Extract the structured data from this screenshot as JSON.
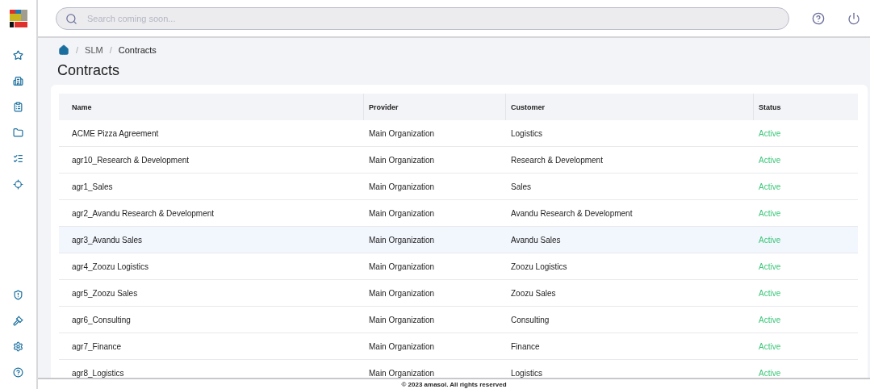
{
  "search": {
    "placeholder": "Search coming soon..."
  },
  "breadcrumb": [
    {
      "kind": "separator",
      "text": "/"
    },
    {
      "kind": "link",
      "text": "SLM"
    },
    {
      "kind": "separator",
      "text": "/"
    },
    {
      "kind": "current",
      "text": "Contracts"
    }
  ],
  "title": "Contracts",
  "table": {
    "columns": [
      "Name",
      "Provider",
      "Customer",
      "Status"
    ],
    "rows": [
      {
        "name": "ACME Pizza Agreement",
        "provider": "Main Organization",
        "customer": "Logistics",
        "status": "Active",
        "selected": false
      },
      {
        "name": "agr10_Research & Development",
        "provider": "Main Organization",
        "customer": "Research & Development",
        "status": "Active",
        "selected": false
      },
      {
        "name": "agr1_Sales",
        "provider": "Main Organization",
        "customer": "Sales",
        "status": "Active",
        "selected": false
      },
      {
        "name": "agr2_Avandu Research & Development",
        "provider": "Main Organization",
        "customer": "Avandu Research & Development",
        "status": "Active",
        "selected": false
      },
      {
        "name": "agr3_Avandu Sales",
        "provider": "Main Organization",
        "customer": "Avandu Sales",
        "status": "Active",
        "selected": true
      },
      {
        "name": "agr4_Zoozu Logistics",
        "provider": "Main Organization",
        "customer": "Zoozu Logistics",
        "status": "Active",
        "selected": false
      },
      {
        "name": "agr5_Zoozu Sales",
        "provider": "Main Organization",
        "customer": "Zoozu Sales",
        "status": "Active",
        "selected": false
      },
      {
        "name": "agr6_Consulting",
        "provider": "Main Organization",
        "customer": "Consulting",
        "status": "Active",
        "selected": false
      },
      {
        "name": "agr7_Finance",
        "provider": "Main Organization",
        "customer": "Finance",
        "status": "Active",
        "selected": false
      },
      {
        "name": "agr8_Logistics",
        "provider": "Main Organization",
        "customer": "Logistics",
        "status": "Active",
        "selected": false
      }
    ]
  },
  "footer": "© 2023 amasol. All rights reserved"
}
